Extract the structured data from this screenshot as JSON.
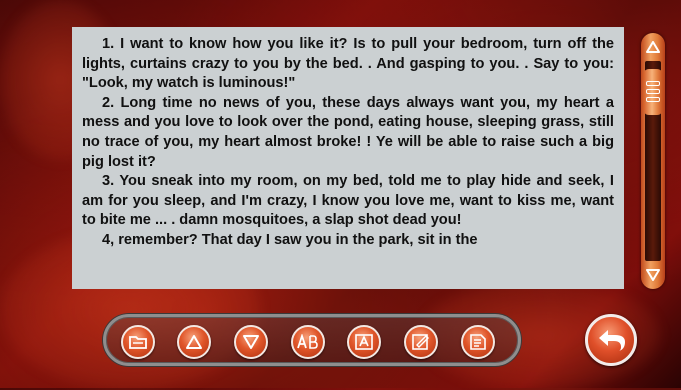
{
  "reader": {
    "paragraphs": [
      "1. I want to know how you like it? Is to pull your bedroom, turn off the lights, curtains crazy to you by the bed. . And gasping to you. . Say to you: \"Look, my watch is luminous!\"",
      "2. Long time no news of you, these days always want you, my heart a mess and you love to look over the pond, eating house, sleeping grass, still no trace of you, my heart almost broke! ! Ye will be able to raise such a big pig lost it?",
      "3. You sneak into my room, on my bed, told me to play hide and seek, I am for you sleep, and I'm crazy, I know you love me, want to kiss me, want to bite me ... . damn mosquitoes, a slap shot dead you!",
      "4, remember? That day I saw you in the park, sit in the"
    ]
  },
  "scrollbar": {
    "position": 0.05,
    "up_icon": "triangle-up-icon",
    "down_icon": "triangle-down-icon",
    "thumb_icon": "grip-lines-icon"
  },
  "toolbar": {
    "buttons": [
      {
        "name": "open-file-button",
        "icon": "folder-icon"
      },
      {
        "name": "page-up-button",
        "icon": "triangle-up-icon"
      },
      {
        "name": "page-down-button",
        "icon": "triangle-down-icon"
      },
      {
        "name": "font-size-button",
        "icon": "ab-font-icon"
      },
      {
        "name": "text-style-button",
        "icon": "text-a-icon"
      },
      {
        "name": "bookmark-edit-button",
        "icon": "note-edit-icon"
      },
      {
        "name": "document-list-button",
        "icon": "document-list-icon"
      }
    ]
  },
  "back": {
    "icon": "return-arrow-icon"
  },
  "colors": {
    "accent": "#e0562a",
    "panel": "#cbd0d2",
    "text": "#111111",
    "background": "#5a0807"
  }
}
